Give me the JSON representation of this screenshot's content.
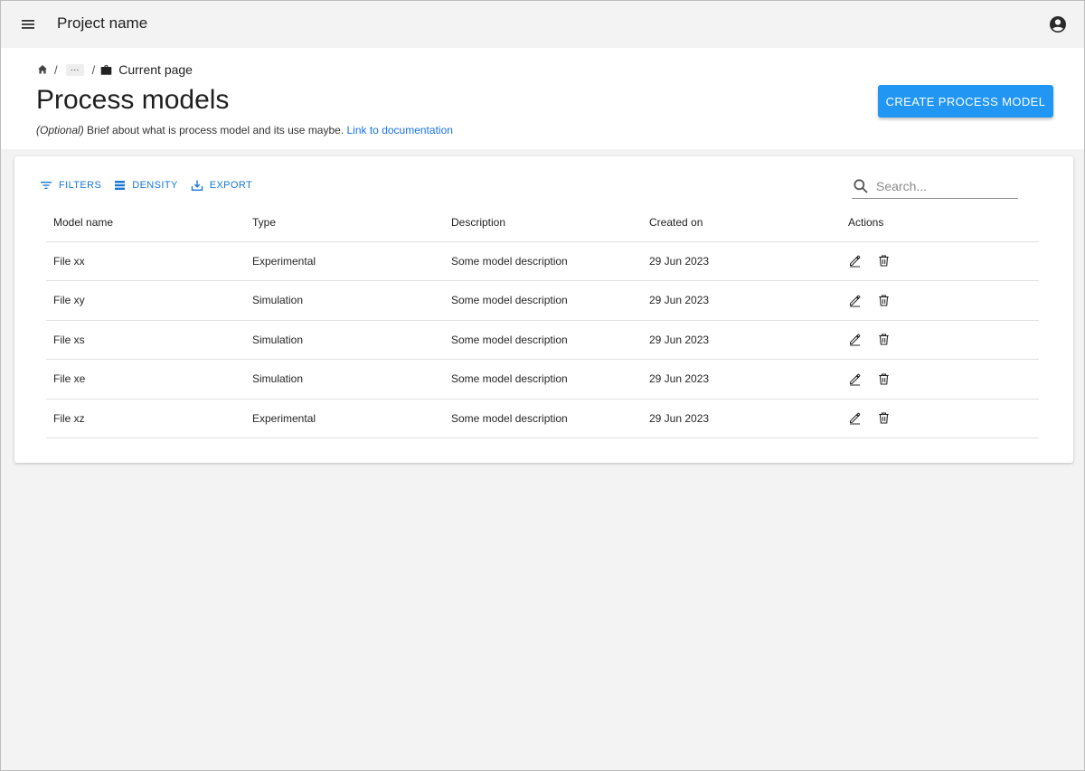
{
  "appbar": {
    "title": "Project name",
    "menu_icon": "hamburger-menu-icon",
    "account_icon": "account-circle-icon"
  },
  "breadcrumb": {
    "home_icon": "home-icon",
    "separator": "/",
    "ellipsis": "···",
    "current_icon": "briefcase-icon",
    "current": "Current page"
  },
  "page": {
    "title": "Process models",
    "desc_optional": "(Optional)",
    "desc_text": " Brief about what is process model and its use maybe. ",
    "desc_link": "Link to documentation",
    "create_label": "CREATE PROCESS MODEL"
  },
  "toolbar": {
    "filters_label": "FILTERS",
    "density_label": "DENSITY",
    "export_label": "EXPORT",
    "search_placeholder": "Search..."
  },
  "table": {
    "headers": {
      "name": "Model name",
      "type": "Type",
      "description": "Description",
      "created": "Created on",
      "actions": "Actions"
    },
    "rows": [
      {
        "name": "File xx",
        "type": "Experimental",
        "description": "Some model description",
        "created": "29 Jun 2023"
      },
      {
        "name": "File xy",
        "type": "Simulation",
        "description": "Some model description",
        "created": "29 Jun 2023"
      },
      {
        "name": "File xs",
        "type": "Simulation",
        "description": "Some model description",
        "created": "29 Jun 2023"
      },
      {
        "name": "File xe",
        "type": "Simulation",
        "description": "Some model description",
        "created": "29 Jun 2023"
      },
      {
        "name": "File xz",
        "type": "Experimental",
        "description": "Some model description",
        "created": "29 Jun 2023"
      }
    ]
  },
  "colors": {
    "accent": "#2196f3",
    "link": "#1976d2",
    "background": "#f3f3f3"
  }
}
